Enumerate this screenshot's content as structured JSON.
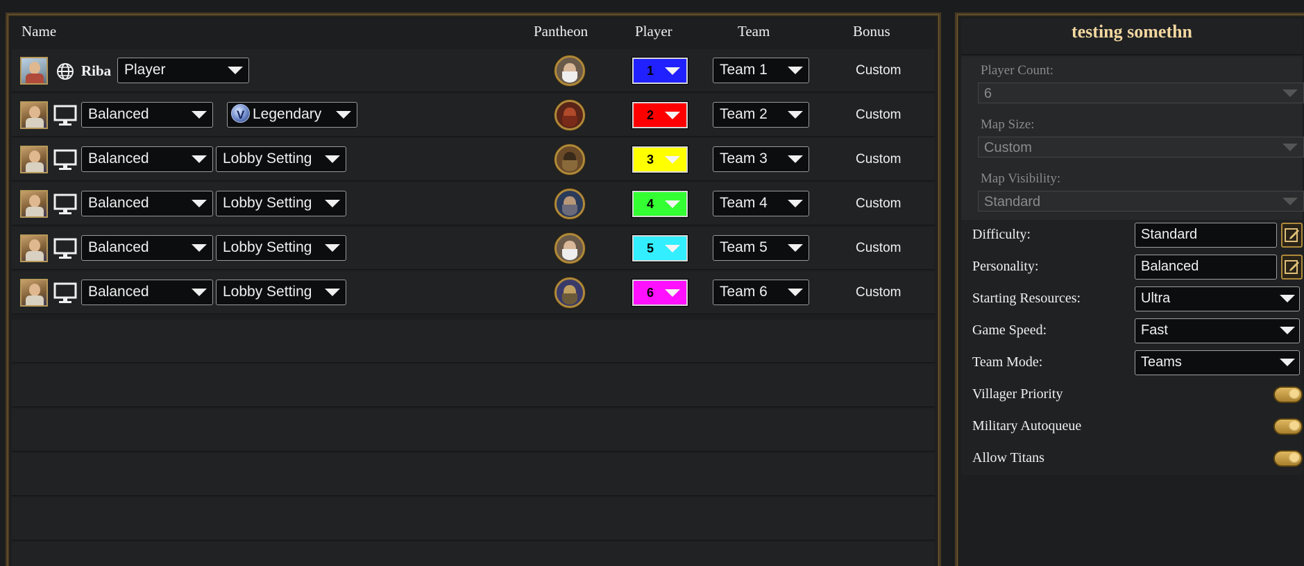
{
  "columns": {
    "name": "Name",
    "pantheon": "Pantheon",
    "player": "Player",
    "team": "Team",
    "bonus": "Bonus"
  },
  "human_player": {
    "name": "Riba",
    "role_value": "Player"
  },
  "players": [
    {
      "type": "human",
      "slot": "1",
      "color": "#2121ff",
      "team": "Team 1",
      "bonus": "Custom",
      "god": "zeus"
    },
    {
      "type": "ai",
      "personality": "Balanced",
      "difficulty": "Legendary",
      "difficulty_badge": true,
      "slot": "2",
      "color": "#ff0000",
      "team": "Team 2",
      "bonus": "Custom",
      "god": "ares"
    },
    {
      "type": "ai",
      "personality": "Balanced",
      "difficulty": "Lobby Setting",
      "slot": "3",
      "color": "#ffff00",
      "team": "Team 3",
      "bonus": "Custom",
      "god": "anubis"
    },
    {
      "type": "ai",
      "personality": "Balanced",
      "difficulty": "Lobby Setting",
      "slot": "4",
      "color": "#33ff33",
      "team": "Team 4",
      "bonus": "Custom",
      "god": "odin"
    },
    {
      "type": "ai",
      "personality": "Balanced",
      "difficulty": "Lobby Setting",
      "slot": "5",
      "color": "#33eeff",
      "team": "Team 5",
      "bonus": "Custom",
      "god": "zeus"
    },
    {
      "type": "ai",
      "personality": "Balanced",
      "difficulty": "Lobby Setting",
      "slot": "6",
      "color": "#ff10ff",
      "team": "Team 6",
      "bonus": "Custom",
      "god": "fuxi"
    }
  ],
  "lobby": {
    "title": "testing somethn",
    "player_count_label": "Player Count:",
    "player_count_value": "6",
    "map_size_label": "Map Size:",
    "map_size_value": "Custom",
    "map_visibility_label": "Map Visibility:",
    "map_visibility_value": "Standard",
    "difficulty_label": "Difficulty:",
    "difficulty_value": "Standard",
    "personality_label": "Personality:",
    "personality_value": "Balanced",
    "starting_resources_label": "Starting Resources:",
    "starting_resources_value": "Ultra",
    "game_speed_label": "Game Speed:",
    "game_speed_value": "Fast",
    "team_mode_label": "Team Mode:",
    "team_mode_value": "Teams",
    "villager_priority_label": "Villager Priority",
    "villager_priority_on": true,
    "military_autoqueue_label": "Military Autoqueue",
    "military_autoqueue_on": true,
    "allow_titans_label": "Allow Titans",
    "allow_titans_on": true
  },
  "icons": {
    "globe": "globe-icon",
    "computer": "computer-icon",
    "edit": "edit-icon",
    "dropdown": "chevron-down-icon"
  }
}
